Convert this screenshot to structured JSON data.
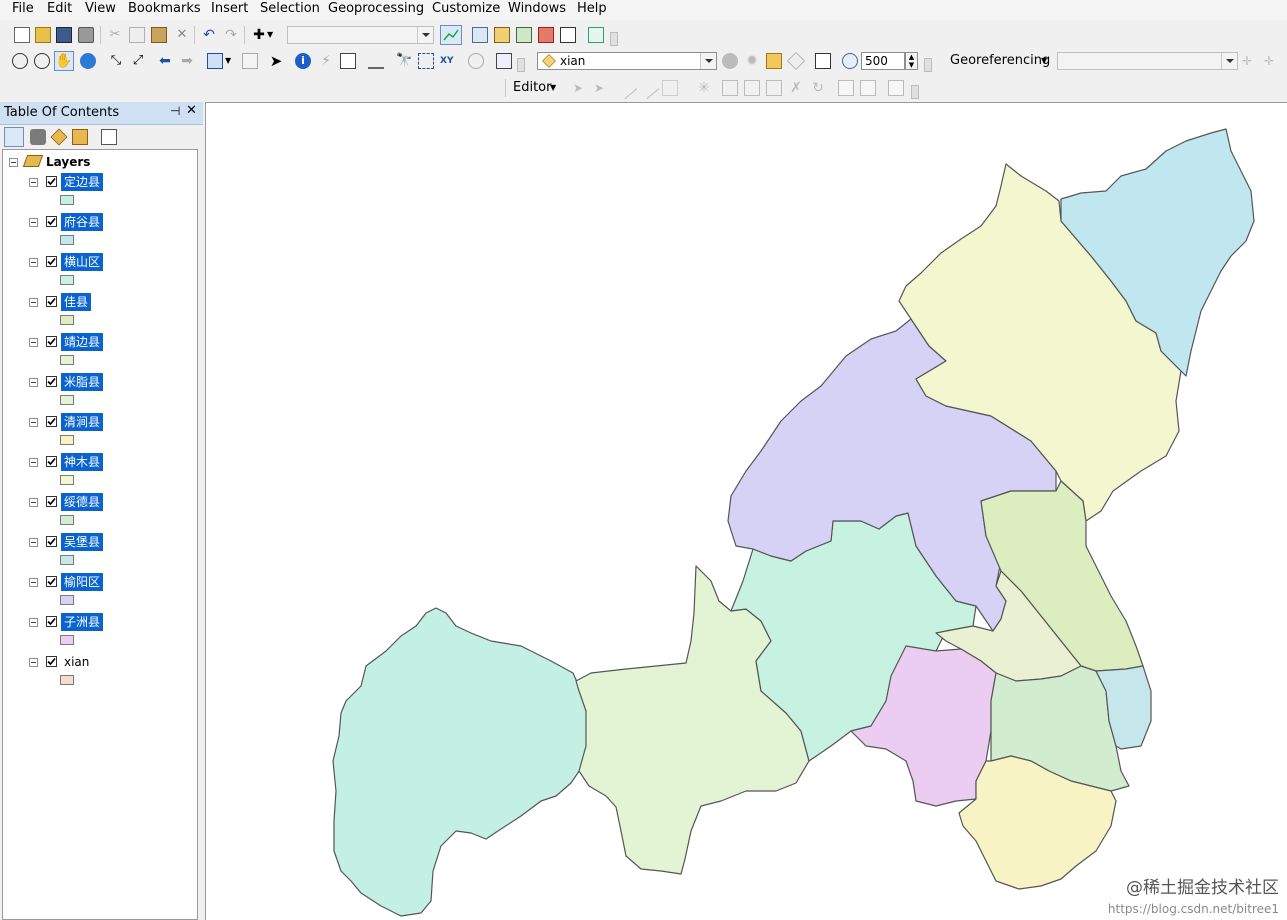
{
  "menubar": {
    "items": [
      "File",
      "Edit",
      "View",
      "Bookmarks",
      "Insert",
      "Selection",
      "Geoprocessing",
      "Customize",
      "Windows",
      "Help"
    ]
  },
  "toolbar": {
    "layer_select_value": "xian",
    "scale_value": "500",
    "georeferencing_label": "Georeferencing",
    "editor_label": "Editor"
  },
  "toc": {
    "title": "Table Of Contents",
    "root_label": "Layers",
    "layers": [
      {
        "name": "定边县",
        "selected": true,
        "color": "#c3f0e2"
      },
      {
        "name": "府谷县",
        "selected": true,
        "color": "#c0e6ef"
      },
      {
        "name": "横山区",
        "selected": true,
        "color": "#c7f1e0"
      },
      {
        "name": "佳县",
        "selected": true,
        "color": "#dcedc0"
      },
      {
        "name": "靖边县",
        "selected": true,
        "color": "#e2f4d4"
      },
      {
        "name": "米脂县",
        "selected": true,
        "color": "#eaf1d2"
      },
      {
        "name": "清涧县",
        "selected": true,
        "color": "#f7f3c4"
      },
      {
        "name": "神木县",
        "selected": true,
        "color": "#f2f7cf"
      },
      {
        "name": "绥德县",
        "selected": true,
        "color": "#d2ecd0"
      },
      {
        "name": "吴堡县",
        "selected": true,
        "color": "#c5e7ec"
      },
      {
        "name": "榆阳区",
        "selected": true,
        "color": "#d6d2f6"
      },
      {
        "name": "子洲县",
        "selected": true,
        "color": "#ebcdf1"
      },
      {
        "name": "xian",
        "selected": false,
        "color": "#f2dccc"
      }
    ]
  },
  "watermark": {
    "line1": "@稀土掘金技术社区",
    "line2": "https://blog.csdn.net/bitree1"
  }
}
